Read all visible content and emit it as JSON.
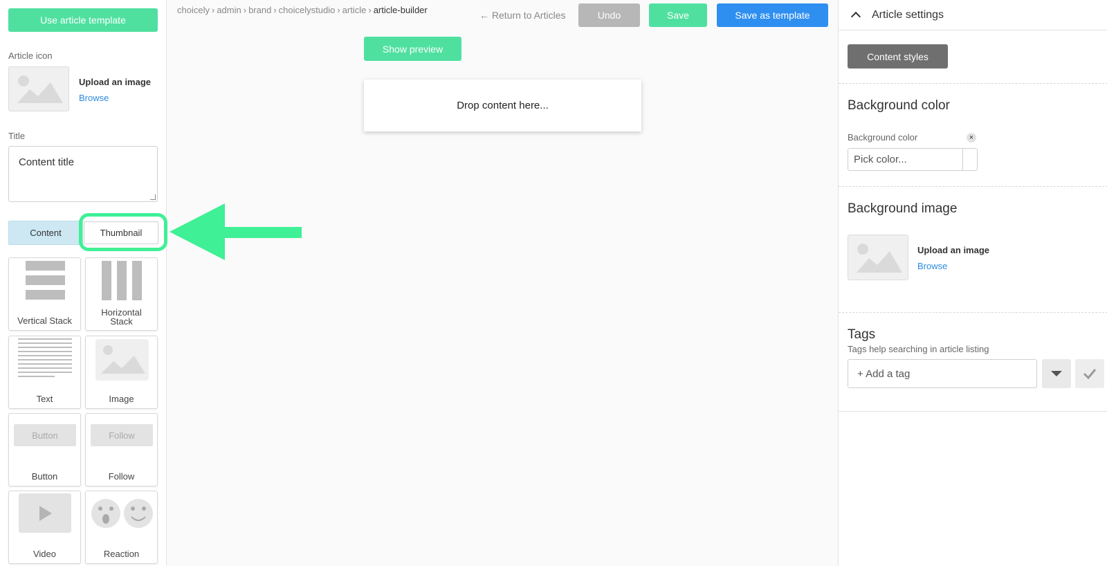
{
  "left": {
    "use_template_label": "Use article template",
    "article_icon_label": "Article icon",
    "upload_title": "Upload an image",
    "browse_label": "Browse",
    "title_label": "Title",
    "title_value": "Content title",
    "tabs": [
      {
        "label": "Content",
        "active": true
      },
      {
        "label": "Thumbnail",
        "active": false
      }
    ],
    "blocks": [
      {
        "label": "Vertical Stack",
        "icon": "vertical-stack-icon"
      },
      {
        "label": "Horizontal Stack",
        "icon": "horizontal-stack-icon"
      },
      {
        "label": "Text",
        "icon": "text-icon"
      },
      {
        "label": "Image",
        "icon": "image-icon"
      },
      {
        "label": "Button",
        "icon": "button-icon",
        "preview_text": "Button"
      },
      {
        "label": "Follow",
        "icon": "follow-icon",
        "preview_text": "Follow"
      },
      {
        "label": "Video",
        "icon": "play-icon"
      },
      {
        "label": "Reaction",
        "icon": "reaction-icon"
      }
    ]
  },
  "header": {
    "breadcrumb": [
      "choicely",
      "admin",
      "brand",
      "choicelystudio",
      "article",
      "article-builder"
    ],
    "return_label": "Return to Articles",
    "undo_label": "Undo",
    "save_label": "Save",
    "save_template_label": "Save as template"
  },
  "canvas": {
    "show_preview_label": "Show preview",
    "dropzone_text": "Drop content here..."
  },
  "right": {
    "settings_title": "Article settings",
    "content_styles_label": "Content styles",
    "bg_color_title": "Background color",
    "bg_color_label": "Background color",
    "bg_color_placeholder": "Pick color...",
    "bg_image_title": "Background image",
    "upload_title": "Upload an image",
    "browse_label": "Browse",
    "tags_title": "Tags",
    "tags_help": "Tags help searching in article listing",
    "tag_placeholder": "+ Add a tag"
  },
  "colors": {
    "accent_green": "#4fe0a0",
    "primary_blue": "#2f8ff0",
    "highlight": "#3ff096"
  }
}
